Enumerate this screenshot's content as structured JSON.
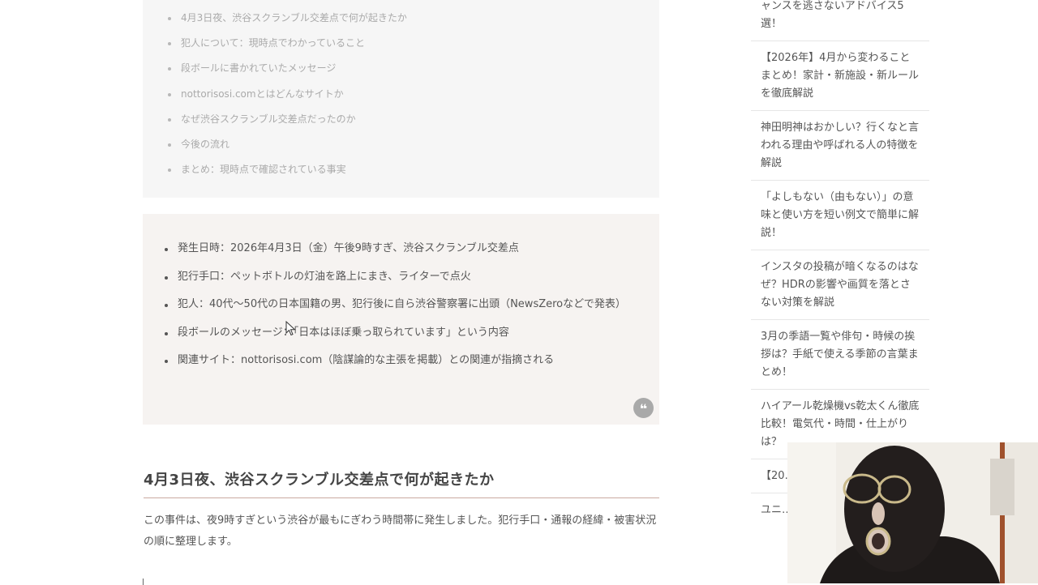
{
  "toc": {
    "items": [
      "4月3日夜、渋谷スクランブル交差点で何が起きたか",
      "犯人について：現時点でわかっていること",
      "段ボールに書かれていたメッセージ",
      "nottorisosi.comとはどんなサイトか",
      "なぜ渋谷スクランブル交差点だったのか",
      "今後の流れ",
      "まとめ：現時点で確認されている事実"
    ]
  },
  "summary": {
    "items": [
      "発生日時：2026年4月3日（金）午後9時すぎ、渋谷スクランブル交差点",
      "犯行手口：ペットボトルの灯油を路上にまき、ライターで点火",
      "犯人：40代～50代の日本国籍の男、犯行後に自ら渋谷警察署に出頭（NewsZeroなどで発表）",
      "段ボールのメッセージ：「日本はほぼ乗っ取られています」という内容",
      "関連サイト：nottorisosi.com（陰謀論的な主張を掲載）との関連が指摘される"
    ]
  },
  "article": {
    "heading": "4月3日夜、渋谷スクランブル交差点で何が起きたか",
    "paragraph": "この事件は、夜9時すぎという渋谷が最もにぎわう時間帯に発生しました。犯行手口・通報の経緯・被害状況の順に整理します。"
  },
  "sidebar": {
    "items": [
      "ャンスを逃さないアドバイス5選！",
      "【2026年】4月から変わることまとめ！家計・新施設・新ルールを徹底解説",
      "神田明神はおかしい？行くなと言われる理由や呼ばれる人の特徴を解説",
      "「よしもない（由もない）」の意味と使い方を短い例文で簡単に解説！",
      "インスタの投稿が暗くなるのはなぜ？HDRの影響や画質を落とさない対策を解説",
      "3月の季語一覧や俳句・時候の挨拶は？手紙で使える季節の言葉まとめ！",
      "ハイアール乾燥機vs乾太くん徹底比較！電気代・時間・仕上がりは？",
      "【20…期は…期ま…",
      "ユニ…トの…材の…"
    ]
  },
  "icons": {
    "quote": "quote-icon",
    "cursor": "mouse-cursor-icon"
  }
}
